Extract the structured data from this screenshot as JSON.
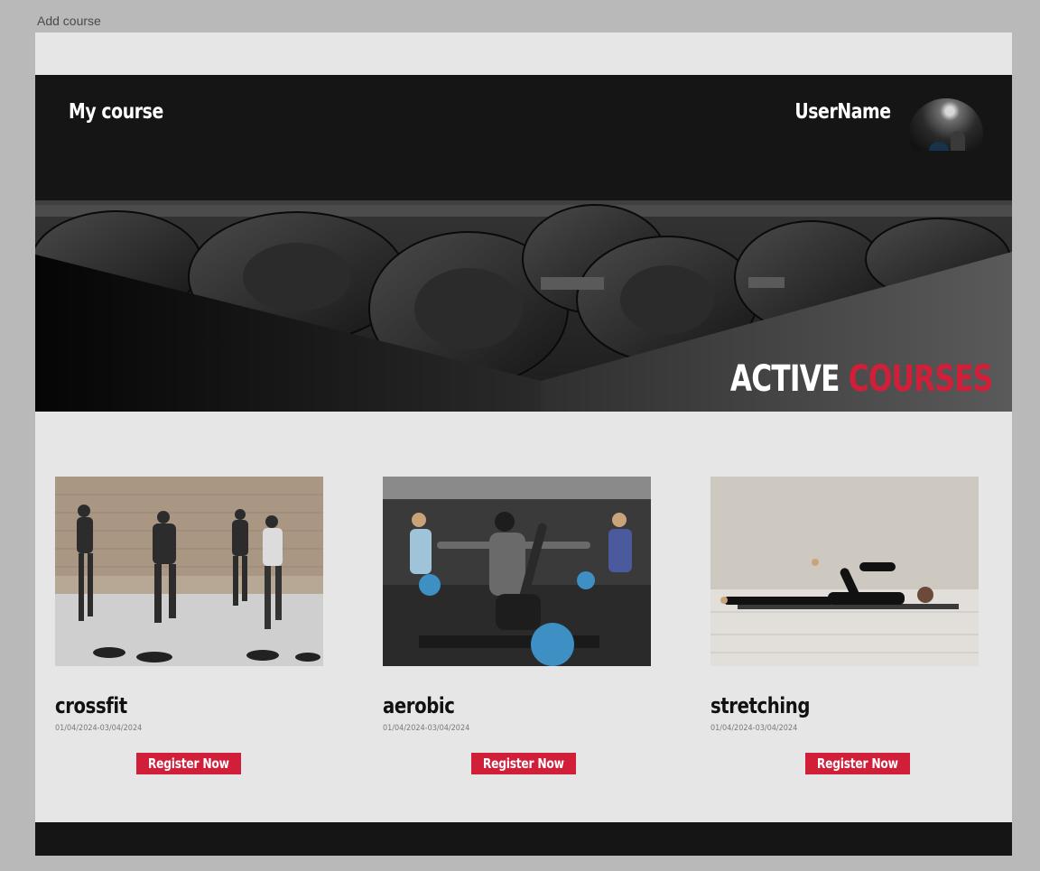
{
  "frame": {
    "label": "Add course"
  },
  "header": {
    "brand": "My course",
    "username": "UserName"
  },
  "hero": {
    "title_white": "ACTIVE",
    "title_red": "COURSES"
  },
  "courses": [
    {
      "name": "crossfit",
      "dates": "01/04/2024-03/04/2024",
      "button": "Register Now"
    },
    {
      "name": "aerobic",
      "dates": "01/04/2024-03/04/2024",
      "button": "Register Now"
    },
    {
      "name": "stretching",
      "dates": "01/04/2024-03/04/2024",
      "button": "Register Now"
    }
  ],
  "colors": {
    "accent": "#d11f3a",
    "dark": "#151515",
    "surface": "#e6e6e6",
    "outer": "#b9b9b9"
  },
  "icons": {
    "avatar": "user-avatar-photo"
  }
}
